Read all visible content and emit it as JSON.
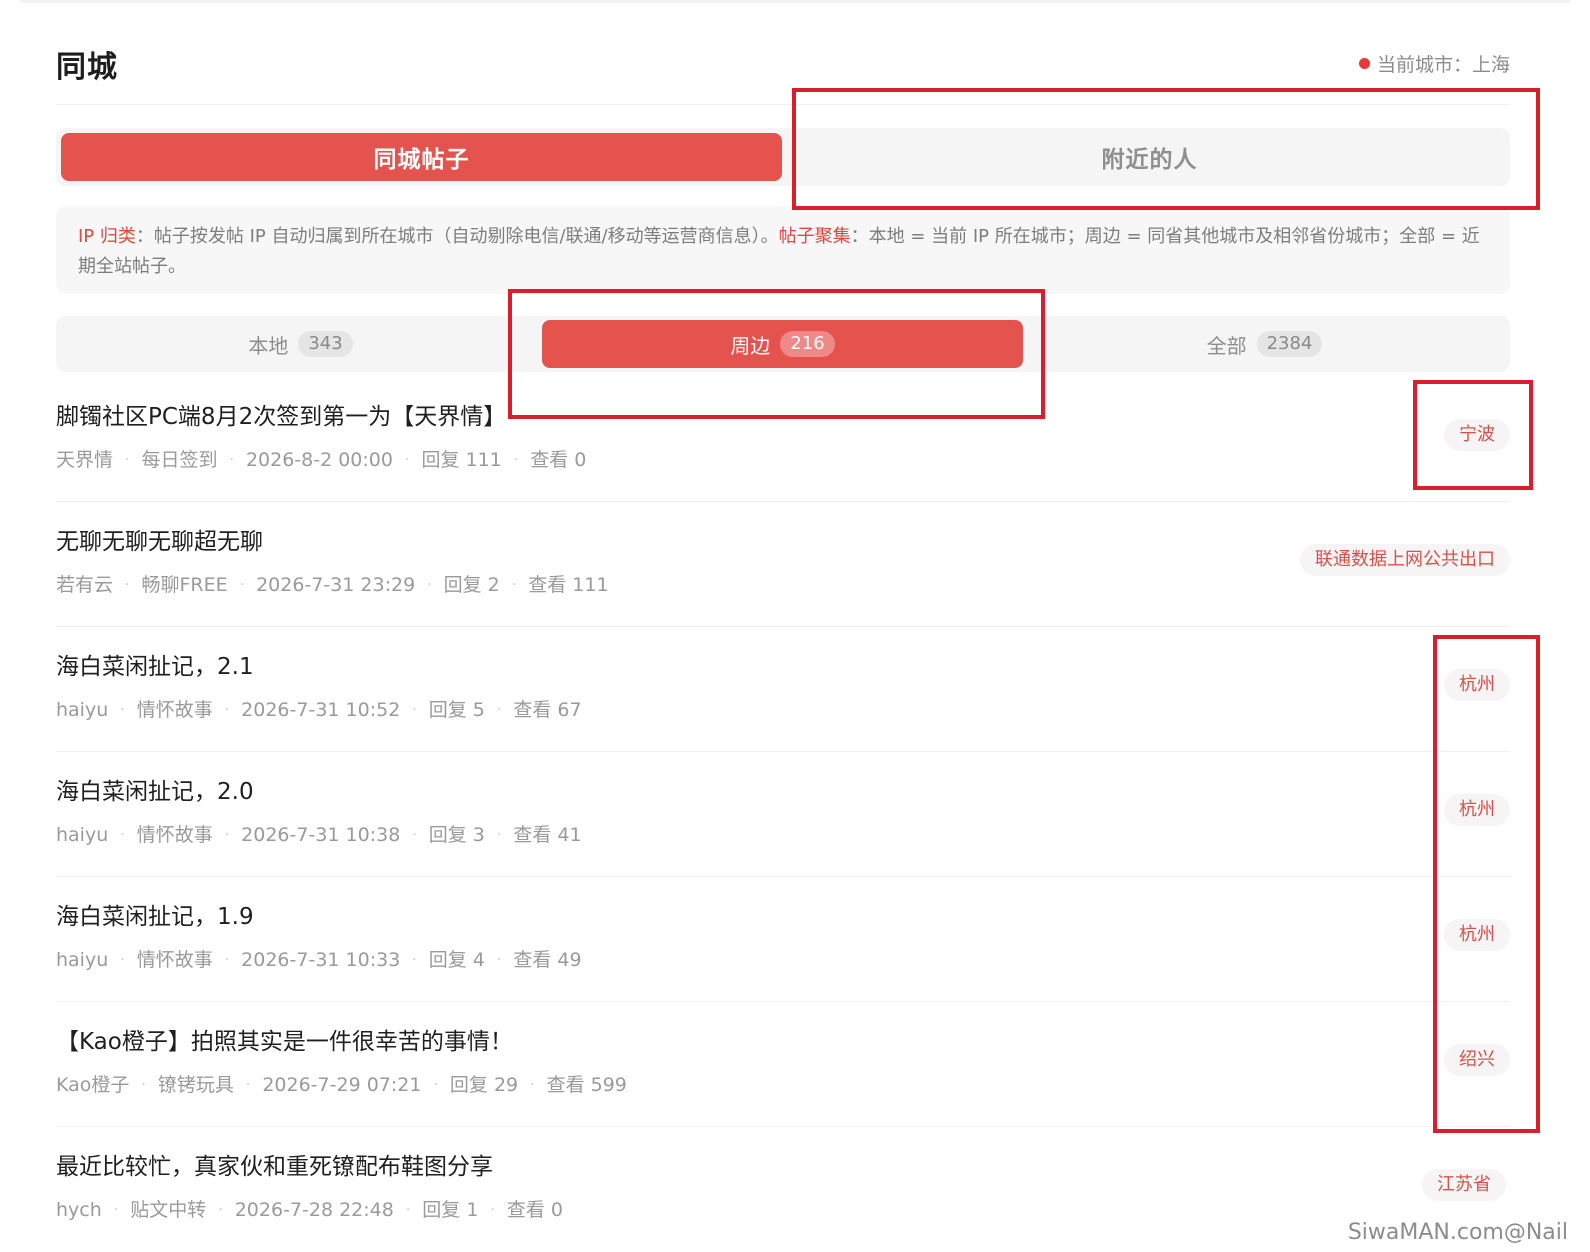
{
  "header": {
    "title": "同城",
    "current_city_label": "当前城市：",
    "current_city": "上海"
  },
  "main_tabs": [
    {
      "label": "同城帖子",
      "active": true
    },
    {
      "label": "附近的人",
      "active": false
    }
  ],
  "info": {
    "key1": "IP 归类",
    "text1": "：帖子按发帖 IP 自动归属到所在城市（自动剔除电信/联通/移动等运营商信息）。",
    "key2": "帖子聚集",
    "text2": "：本地 = 当前 IP 所在城市；周边 = 同省其他城市及相邻省份城市；全部 = 近期全站帖子。"
  },
  "sub_tabs": [
    {
      "label": "本地",
      "count": "343",
      "active": false
    },
    {
      "label": "周边",
      "count": "216",
      "active": true
    },
    {
      "label": "全部",
      "count": "2384",
      "active": false
    }
  ],
  "posts": [
    {
      "title": "脚镯社区PC端8月2次签到第一为【天界情】",
      "author": "天界情",
      "forum": "每日签到",
      "date": "2026-8-2 00:00",
      "replies": "回复 111",
      "views": "查看 0",
      "location": "宁波"
    },
    {
      "title": "无聊无聊无聊超无聊",
      "author": "若有云",
      "forum": "畅聊FREE",
      "date": "2026-7-31 23:29",
      "replies": "回复 2",
      "views": "查看 111",
      "location": "联通数据上网公共出口"
    },
    {
      "title": "海白菜闲扯记，2.1",
      "author": "haiyu",
      "forum": "情怀故事",
      "date": "2026-7-31 10:52",
      "replies": "回复 5",
      "views": "查看 67",
      "location": "杭州"
    },
    {
      "title": "海白菜闲扯记，2.0",
      "author": "haiyu",
      "forum": "情怀故事",
      "date": "2026-7-31 10:38",
      "replies": "回复 3",
      "views": "查看 41",
      "location": "杭州"
    },
    {
      "title": "海白菜闲扯记，1.9",
      "author": "haiyu",
      "forum": "情怀故事",
      "date": "2026-7-31 10:33",
      "replies": "回复 4",
      "views": "查看 49",
      "location": "杭州"
    },
    {
      "title": "【Kao橙子】拍照其实是一件很幸苦的事情！",
      "author": "Kao橙子",
      "forum": "镣铐玩具",
      "date": "2026-7-29 07:21",
      "replies": "回复 29",
      "views": "查看 599",
      "location": "绍兴"
    },
    {
      "title": "最近比较忙，真家伙和重死镣配布鞋图分享",
      "author": "hych",
      "forum": "贴文中转",
      "date": "2026-7-28 22:48",
      "replies": "回复 1",
      "views": "查看 0",
      "location": "江苏省"
    }
  ],
  "watermark": "SiwaMAN.com@Nail",
  "colors": {
    "accent": "#e5534f",
    "annotation": "#d91f2b",
    "tag_text": "#d9504a"
  }
}
